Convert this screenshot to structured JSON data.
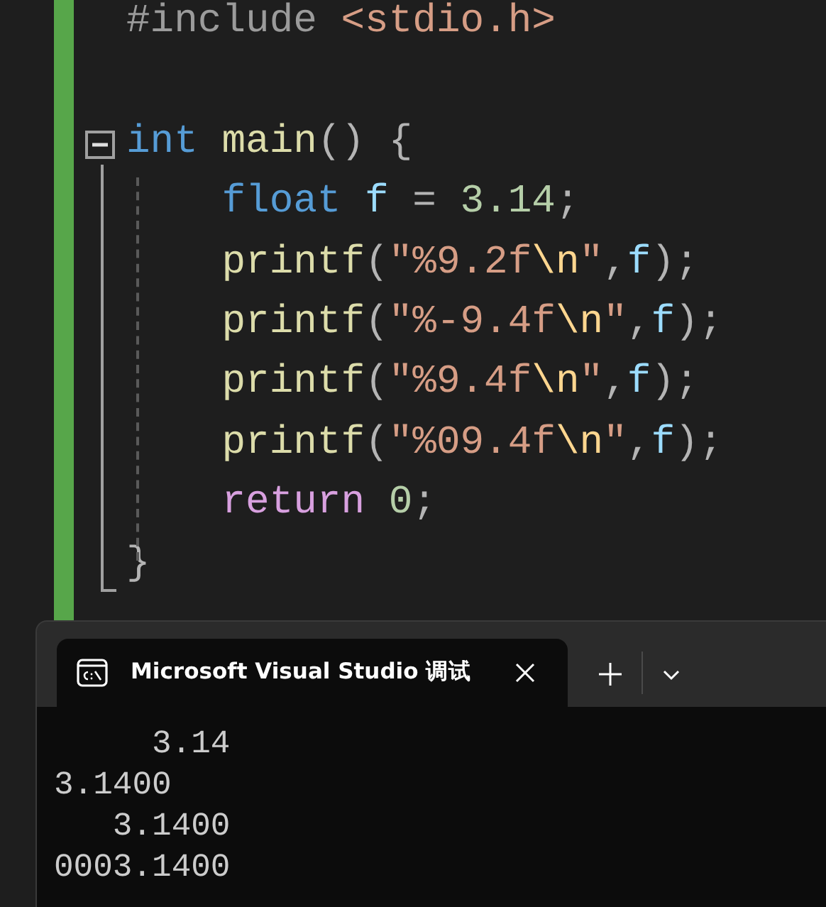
{
  "editor": {
    "fold": {
      "expanded": true
    },
    "lines": [
      {
        "kind": "code",
        "tokens": [
          {
            "text": "#include ",
            "kind": "preprocessor"
          },
          {
            "text": "<stdio.h>",
            "kind": "string"
          }
        ]
      },
      {
        "kind": "blank"
      },
      {
        "kind": "code",
        "tokens": [
          {
            "text": "int",
            "kind": "keyword"
          },
          {
            "text": " main",
            "kind": "function"
          },
          {
            "text": "() {",
            "kind": "punct"
          }
        ]
      },
      {
        "kind": "code",
        "tokens": [
          {
            "text": "    float",
            "kind": "keyword"
          },
          {
            "text": " f",
            "kind": "variable"
          },
          {
            "text": " = ",
            "kind": "punct"
          },
          {
            "text": "3.14",
            "kind": "number"
          },
          {
            "text": ";",
            "kind": "punct"
          }
        ]
      },
      {
        "kind": "code",
        "tokens": [
          {
            "text": "    printf",
            "kind": "function"
          },
          {
            "text": "(",
            "kind": "punct"
          },
          {
            "text": "\"%9.2f",
            "kind": "string"
          },
          {
            "text": "\\n",
            "kind": "escape"
          },
          {
            "text": "\"",
            "kind": "string"
          },
          {
            "text": ",",
            "kind": "punct"
          },
          {
            "text": "f",
            "kind": "variable"
          },
          {
            "text": ");",
            "kind": "punct"
          }
        ]
      },
      {
        "kind": "code",
        "tokens": [
          {
            "text": "    printf",
            "kind": "function"
          },
          {
            "text": "(",
            "kind": "punct"
          },
          {
            "text": "\"%-9.4f",
            "kind": "string"
          },
          {
            "text": "\\n",
            "kind": "escape"
          },
          {
            "text": "\"",
            "kind": "string"
          },
          {
            "text": ",",
            "kind": "punct"
          },
          {
            "text": "f",
            "kind": "variable"
          },
          {
            "text": ");",
            "kind": "punct"
          }
        ]
      },
      {
        "kind": "code",
        "tokens": [
          {
            "text": "    printf",
            "kind": "function"
          },
          {
            "text": "(",
            "kind": "punct"
          },
          {
            "text": "\"%9.4f",
            "kind": "string"
          },
          {
            "text": "\\n",
            "kind": "escape"
          },
          {
            "text": "\"",
            "kind": "string"
          },
          {
            "text": ",",
            "kind": "punct"
          },
          {
            "text": "f",
            "kind": "variable"
          },
          {
            "text": ");",
            "kind": "punct"
          }
        ]
      },
      {
        "kind": "code",
        "tokens": [
          {
            "text": "    printf",
            "kind": "function"
          },
          {
            "text": "(",
            "kind": "punct"
          },
          {
            "text": "\"%09.4f",
            "kind": "string"
          },
          {
            "text": "\\n",
            "kind": "escape"
          },
          {
            "text": "\"",
            "kind": "string"
          },
          {
            "text": ",",
            "kind": "punct"
          },
          {
            "text": "f",
            "kind": "variable"
          },
          {
            "text": ");",
            "kind": "punct"
          }
        ]
      },
      {
        "kind": "code",
        "tokens": [
          {
            "text": "    return",
            "kind": "control"
          },
          {
            "text": " 0",
            "kind": "number"
          },
          {
            "text": ";",
            "kind": "punct"
          }
        ]
      },
      {
        "kind": "code",
        "tokens": [
          {
            "text": "}",
            "kind": "punct"
          }
        ]
      }
    ]
  },
  "terminal": {
    "tab": {
      "title": "Microsoft Visual Studio 调试",
      "selected": true
    },
    "output": [
      "     3.14",
      "3.1400",
      "   3.1400",
      "0003.1400"
    ]
  }
}
